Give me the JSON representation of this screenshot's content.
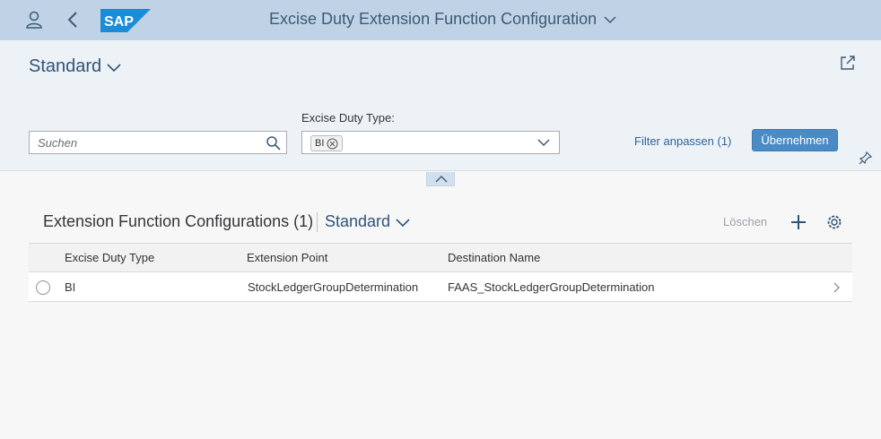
{
  "shell": {
    "title": "Excise Duty Extension Function Configuration",
    "logo_text": "SAP"
  },
  "header": {
    "variant": "Standard"
  },
  "filterbar": {
    "search_placeholder": "Suchen",
    "excise_label": "Excise Duty Type:",
    "excise_token": "BI",
    "adapt_filters": "Filter anpassen (1)",
    "go": "Übernehmen"
  },
  "table": {
    "title": "Extension Function Configurations (1)",
    "variant": "Standard",
    "delete_label": "Löschen",
    "columns": [
      "Excise Duty Type",
      "Extension Point",
      "Destination Name"
    ],
    "rows": [
      {
        "type": "BI",
        "extension_point": "StockLedgerGroupDetermination",
        "destination": "FAAS_StockLedgerGroupDetermination"
      }
    ]
  },
  "colors": {
    "shellbar": "#c0d3e6",
    "accent": "#4a8bc6",
    "link": "#2f6497"
  },
  "icons": [
    "user-icon",
    "back-icon",
    "share-icon",
    "search-icon",
    "chevron-down-icon",
    "pin-icon",
    "collapse-icon",
    "add-icon",
    "settings-icon",
    "navigation-arrow-icon"
  ]
}
